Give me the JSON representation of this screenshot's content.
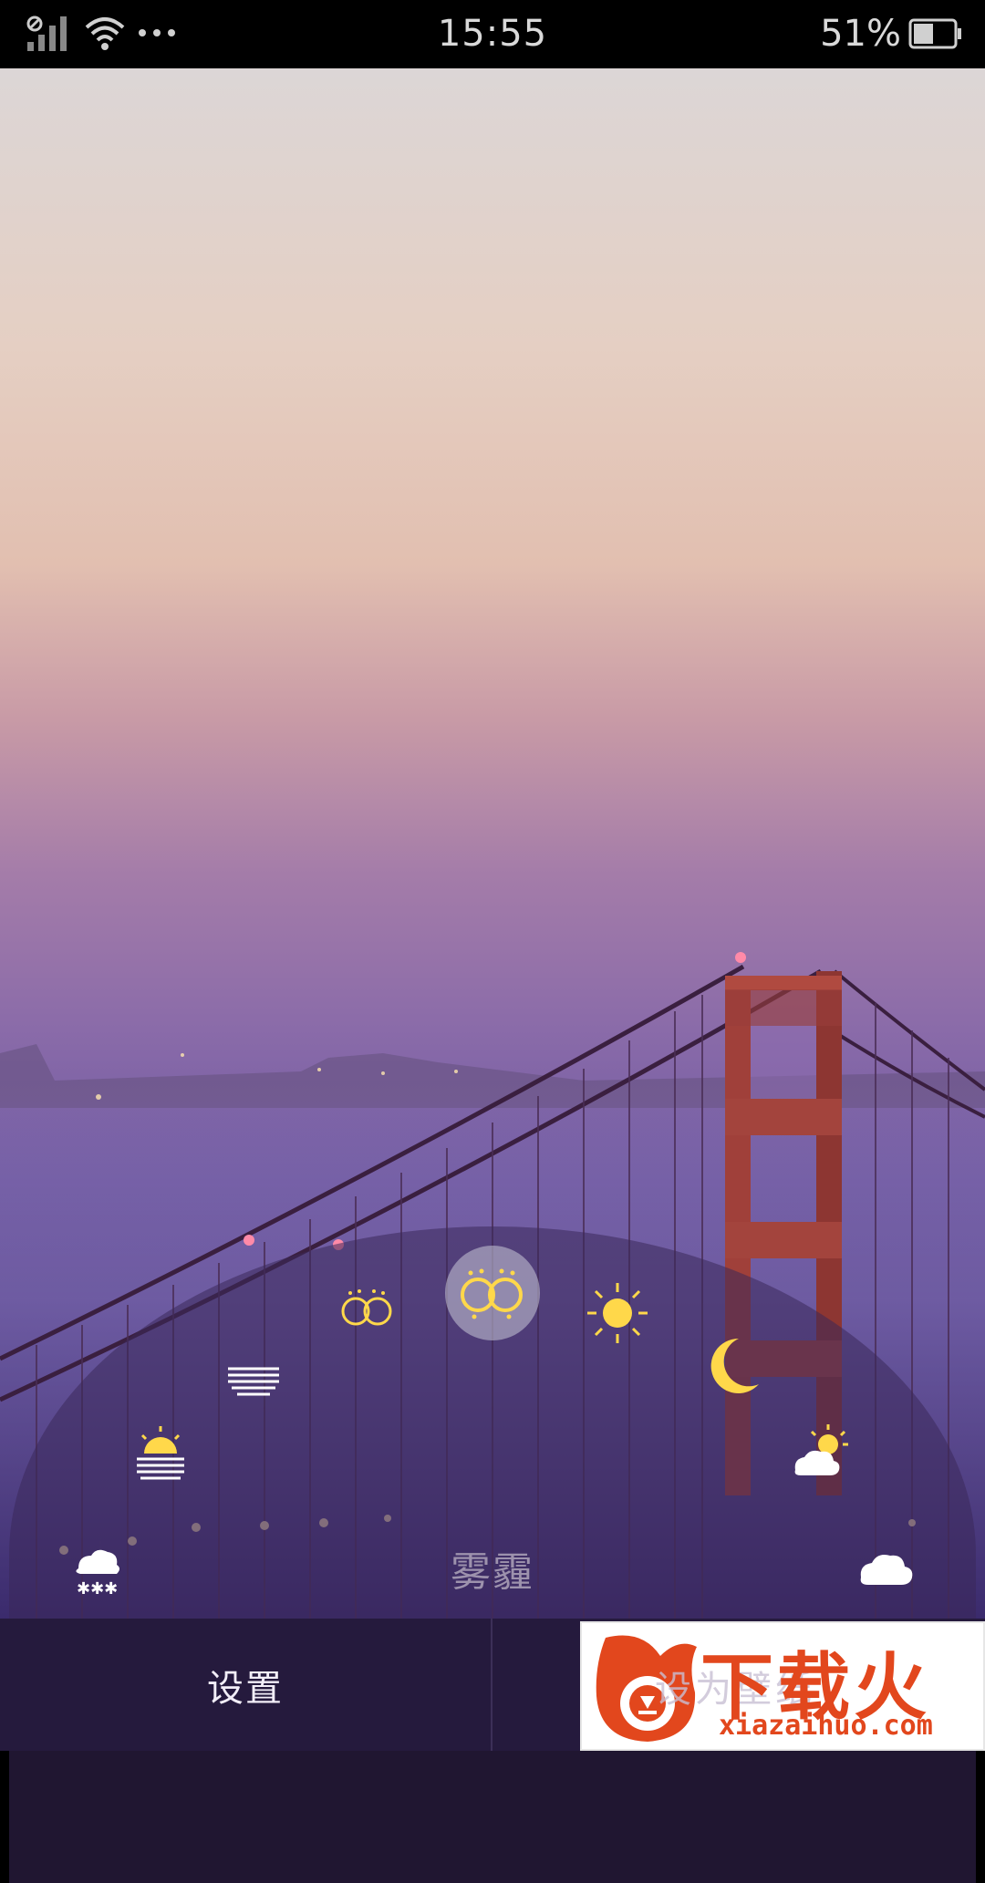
{
  "status_bar": {
    "time": "15:55",
    "battery_percent": "51%",
    "battery_level": 0.51,
    "icons": [
      "no-sim-signal-icon",
      "wifi-icon",
      "more-dots-icon",
      "battery-icon"
    ]
  },
  "weather_selector": {
    "selected_label": "雾霾",
    "selected_index": 4,
    "accent_color": "#ffd84a",
    "items": [
      {
        "icon": "night-snow-icon"
      },
      {
        "icon": "sunrise-haze-icon"
      },
      {
        "icon": "moon-haze-icon"
      },
      {
        "icon": "haze-icon"
      },
      {
        "icon": "smog-icon"
      },
      {
        "icon": "sun-icon"
      },
      {
        "icon": "moon-icon"
      },
      {
        "icon": "partly-sunny-icon"
      },
      {
        "icon": "partly-cloudy-night-icon"
      }
    ]
  },
  "bottom_bar": {
    "settings_label": "设置",
    "set_wallpaper_label": "设为壁纸"
  },
  "watermark": {
    "brand": "下载火",
    "url": "xiazaihuo.com"
  }
}
